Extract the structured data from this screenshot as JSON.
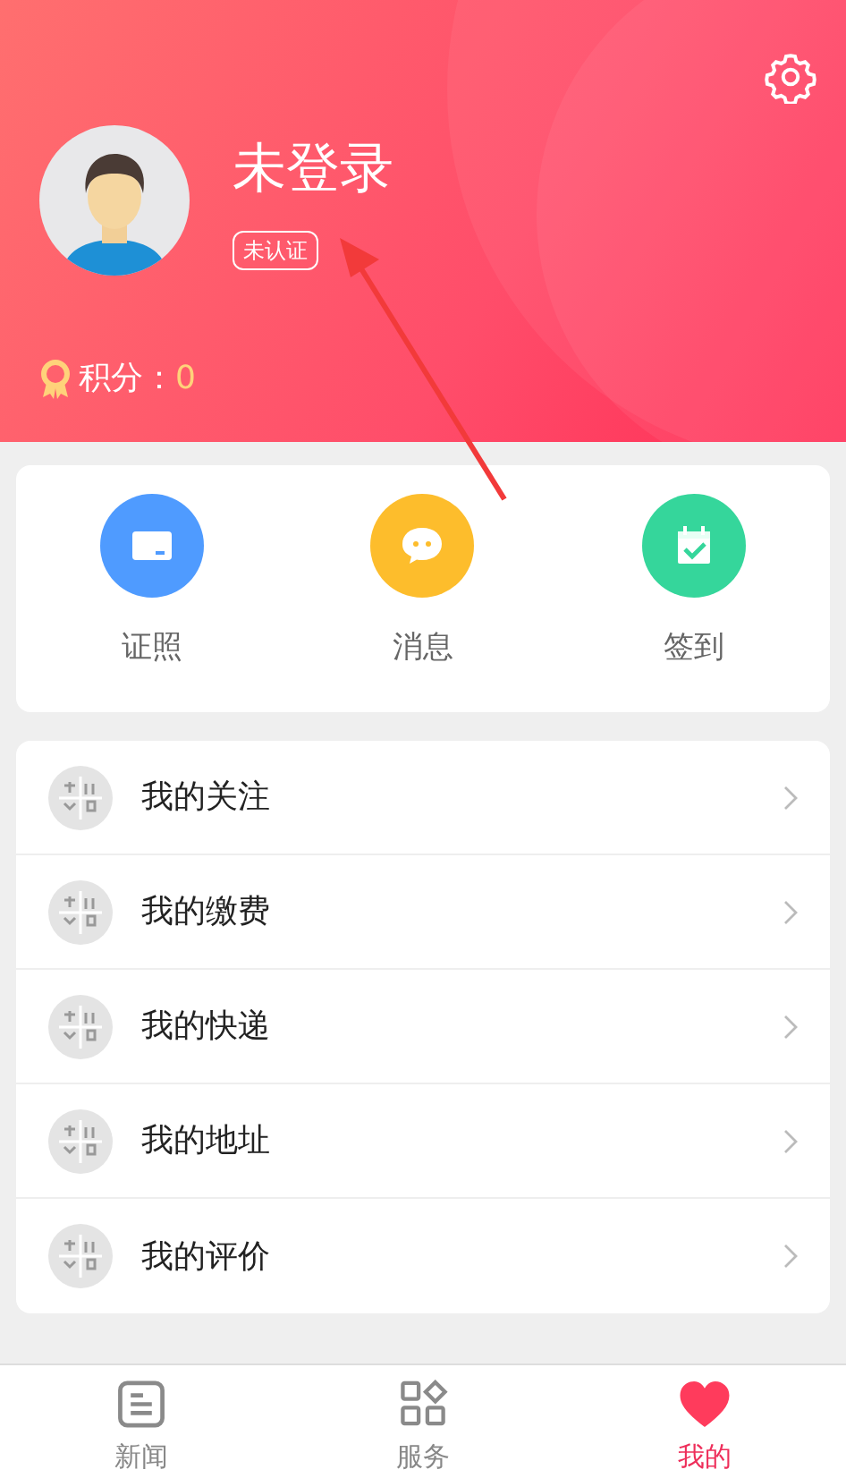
{
  "header": {
    "title": "未登录",
    "badge": "未认证",
    "points_label": "积分：",
    "points_value": "0"
  },
  "shortcuts": [
    {
      "label": "证照",
      "kind": "card",
      "color": "#4f9bff"
    },
    {
      "label": "消息",
      "kind": "chat",
      "color": "#fdbd2c"
    },
    {
      "label": "签到",
      "kind": "calendar",
      "color": "#35d69b"
    }
  ],
  "menu": [
    {
      "label": "我的关注"
    },
    {
      "label": "我的缴费"
    },
    {
      "label": "我的快递"
    },
    {
      "label": "我的地址"
    },
    {
      "label": "我的评价"
    }
  ],
  "tab_bar": [
    {
      "label": "新闻",
      "kind": "news",
      "selected": false
    },
    {
      "label": "服务",
      "kind": "services",
      "selected": false
    },
    {
      "label": "我的",
      "kind": "heart",
      "selected": true
    }
  ]
}
